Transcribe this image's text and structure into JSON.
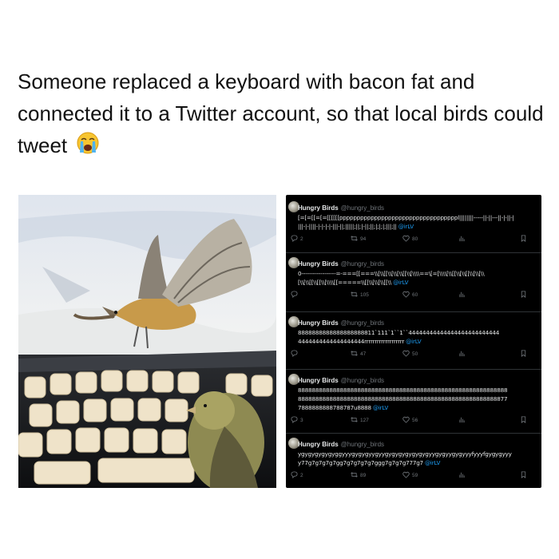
{
  "caption": {
    "text": "Someone replaced a keyboard with bacon fat and connected it to a Twitter account, so that local birds could tweet",
    "emoji": "loudly-crying-face"
  },
  "photo": {
    "subject": "birds-on-bacon-keyboard"
  },
  "tweets": [
    {
      "name": "Hungry Birds",
      "handle": "@hungry_birds",
      "lines": [
        "[=[=[[=[=[[[[[[ppppppppppppppppppppppppppppppppppl||||||||-----||-||---||-|-||-|",
        "|||-|-||||-|-|-|-|-|||-||;|||||;||;|-||;||;|;|;|;|||;||"
      ],
      "mention": "@irLV",
      "replies": "2",
      "retweets": "94",
      "likes": "80"
    },
    {
      "name": "Hungry Birds",
      "handle": "@hungry_birds",
      "lines": [
        "0------------------=-===[[===\\\\[\\\\[[\\\\[\\\\[\\\\[[\\\\[\\\\\\\\==\\[=[\\\\\\\\[\\\\[[\\\\[\\\\[[\\\\[\\\\[\\\\",
        "[\\\\[\\\\[[\\\\[[\\\\[\\\\\\\\[[=====\\\\[[\\\\[\\\\[\\\\[[\\\\"
      ],
      "mention": "@irLV",
      "replies": "",
      "retweets": "105",
      "likes": "60"
    },
    {
      "name": "Hungry Birds",
      "handle": "@hungry_birds",
      "lines": [
        "8888888888888888888811`111`1``1``44444444444444444444444444",
        "4444444444444444444rrrrrrrrrrrrrrrrrrr"
      ],
      "mention": "@irLV",
      "replies": "",
      "retweets": "47",
      "likes": "50"
    },
    {
      "name": "Hungry Birds",
      "handle": "@hungry_birds",
      "lines": [
        "888888888888888888888888888888888888888888888888888888888888",
        "888888888888888888888888888888888888888888888888888888888877",
        "7888888888788787u8888"
      ],
      "mention": "@irLV",
      "replies": "3",
      "retweets": "127",
      "likes": "56"
    },
    {
      "name": "Hungry Birds",
      "handle": "@hungry_birds",
      "lines": [
        "ygygygygygyggyyygygygyygyygygygygygygygyygygyygygyyyfyyyfgygygyyy",
        "y77g7g7g7g7gg7g7g7g7g7ggg7g7g7g777g7"
      ],
      "mention": "@irLV",
      "replies": "2",
      "retweets": "89",
      "likes": "59"
    }
  ],
  "icons": {
    "reply": "reply-icon",
    "retweet": "retweet-icon",
    "like": "heart-icon",
    "views": "views-icon",
    "bookmark": "bookmark-icon"
  },
  "colors": {
    "feed_bg": "#000000",
    "text": "#e7e9ea",
    "muted": "#71767b",
    "link": "#1d9bf0"
  }
}
